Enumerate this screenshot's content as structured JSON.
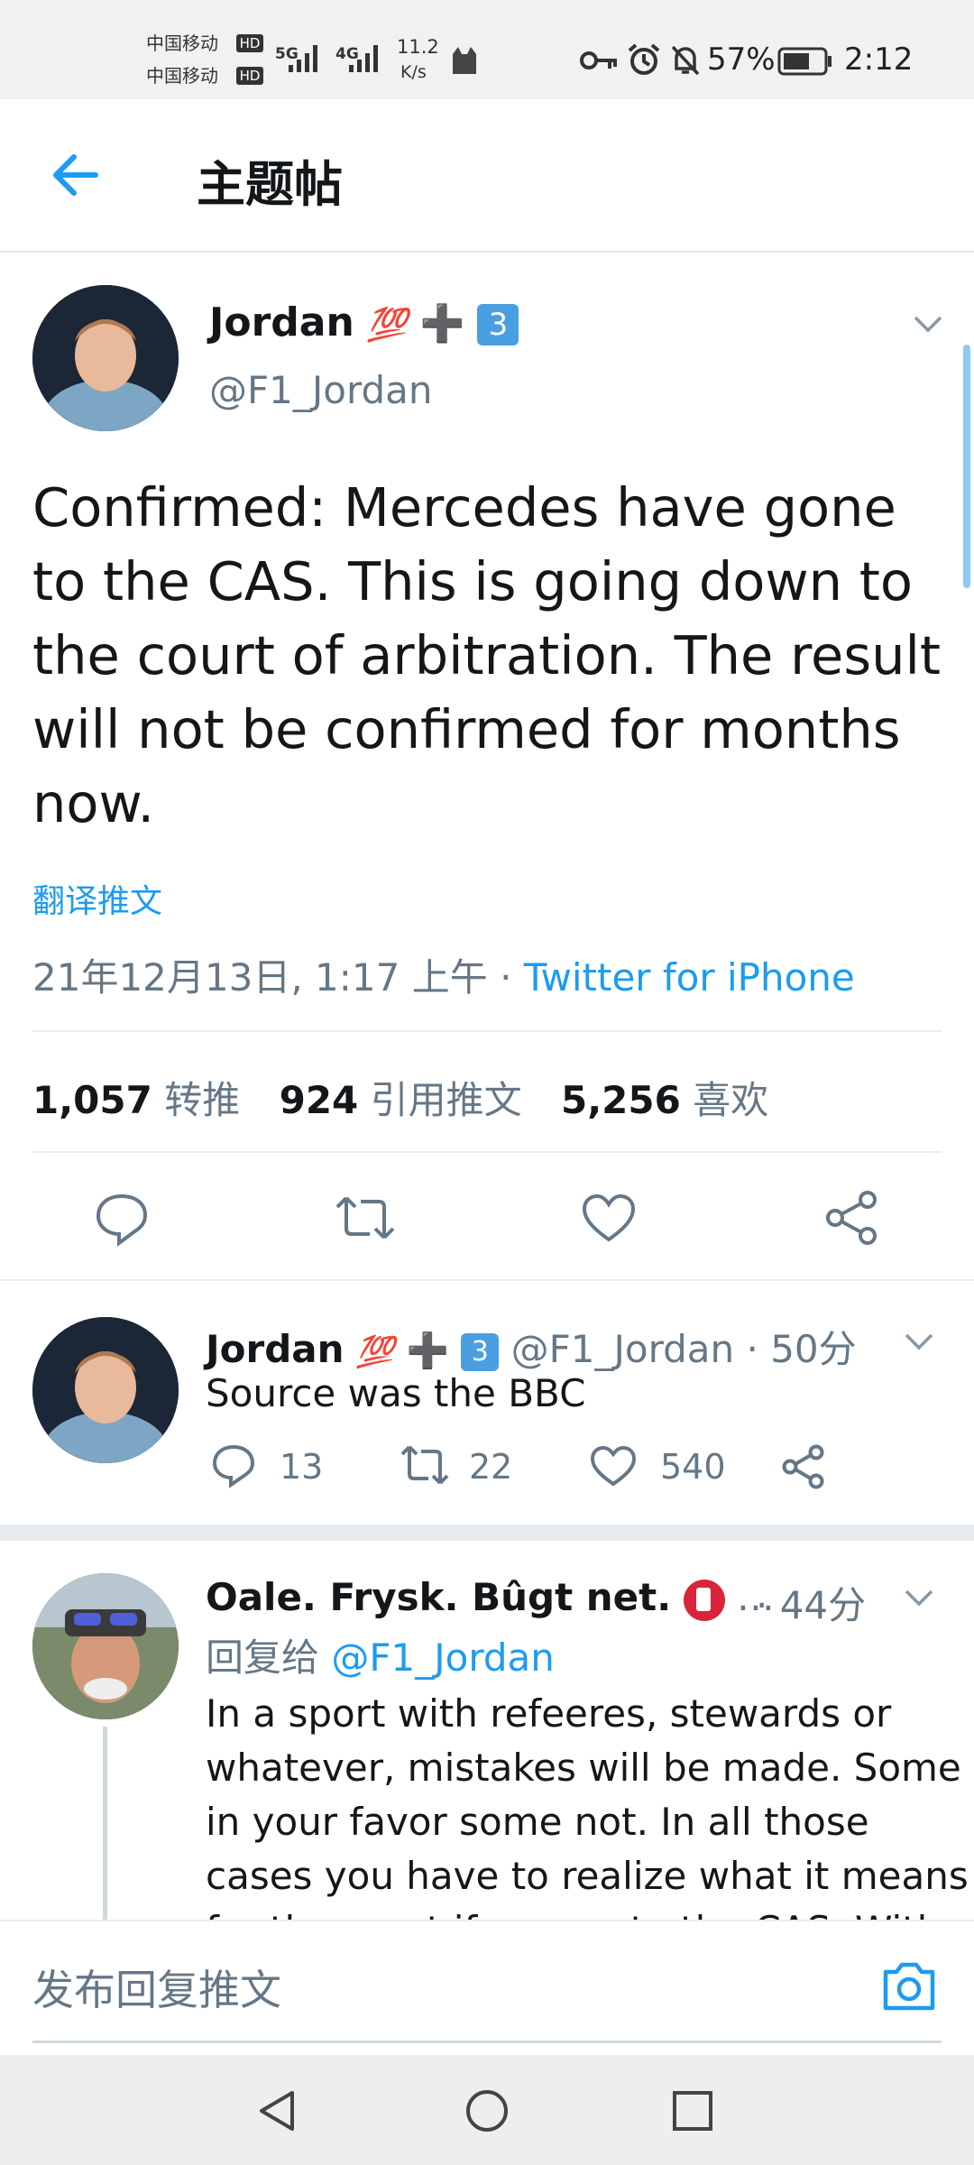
{
  "status_bar": {
    "carrier1": "中国移动",
    "carrier2": "中国移动",
    "hd": "HD",
    "net1": "5G",
    "net2": "4G",
    "speed_value": "11.2",
    "speed_unit": "K/s",
    "battery": "57%",
    "time": "2:12"
  },
  "header": {
    "title": "主题帖"
  },
  "main_tweet": {
    "author_name": "Jordan",
    "emoji_hundred": "💯",
    "emoji_plus": "➕",
    "emoji_three": "3",
    "handle": "@F1_Jordan",
    "text": "Confirmed: Mercedes have gone to the CAS. This is going down to the court of arbitration. The result will not be confirmed for months now.",
    "translate": "翻译推文",
    "timestamp": "21年12月13日, 1:17 上午",
    "dot": "·",
    "source": "Twitter for iPhone",
    "retweets_count": "1,057",
    "retweets_label": "转推",
    "quotes_count": "924",
    "quotes_label": "引用推文",
    "likes_count": "5,256",
    "likes_label": "喜欢"
  },
  "replies": [
    {
      "author_name": "Jordan",
      "handle": "@F1_Jordan",
      "time": "· 50分",
      "text": "Source was the BBC",
      "reply_count": "13",
      "retweet_count": "22",
      "like_count": "540"
    },
    {
      "author_name": "Oale. Frysk. Bûgt net.",
      "ellipsis": "…",
      "time": "· 44分",
      "reply_to_prefix": "回复给",
      "reply_to_handle": "@F1_Jordan",
      "text_lines": [
        "In a sport with refeeres, stewards or",
        "whatever, mistakes will be made. Some",
        "in your favor some not. In all those",
        "cases you have to realize what it means",
        "for the sport if you go to the CAS. With"
      ]
    }
  ],
  "reply_bar": {
    "placeholder": "发布回复推文"
  },
  "colors": {
    "accent": "#1d9bf0",
    "muted": "#657786",
    "text": "#14171a"
  }
}
